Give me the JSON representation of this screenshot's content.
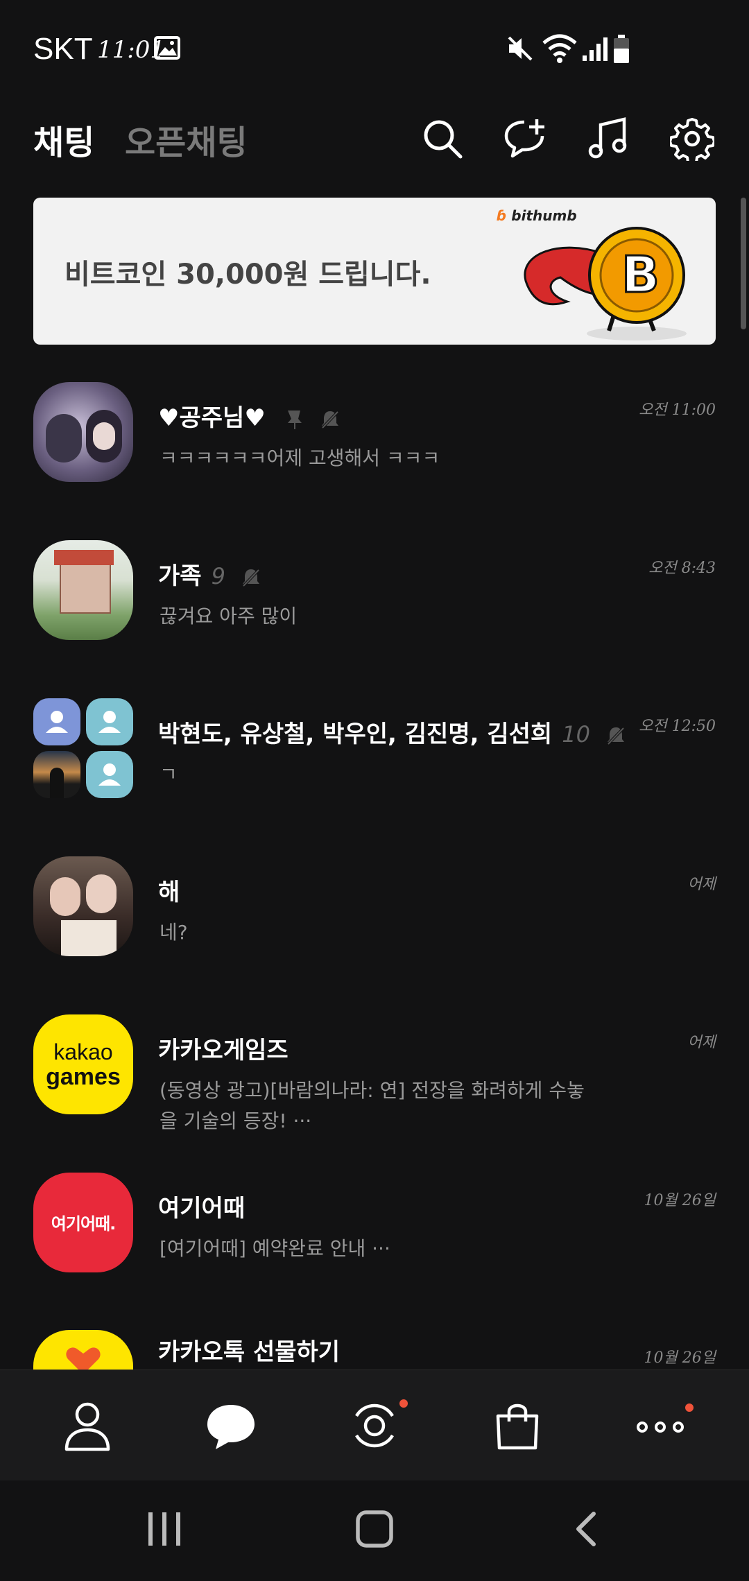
{
  "status_bar": {
    "carrier": "SKT",
    "time": "11:01"
  },
  "header": {
    "tabs": [
      {
        "label": "채팅",
        "active": true
      },
      {
        "label": "오픈채팅",
        "active": false
      }
    ]
  },
  "banner": {
    "text": "비트코인 30,000원 드립니다.",
    "brand": "bithumb"
  },
  "chats": [
    {
      "name": "♥공주님♥",
      "count": "",
      "preview": "ㅋㅋㅋㅋㅋㅋ어제 고생해서 ㅋㅋㅋ",
      "time": "오전 11:00",
      "pinned": true,
      "muted": true
    },
    {
      "name": "가족",
      "count": "9",
      "preview": "끊겨요 아주 많이",
      "time": "오전 8:43",
      "muted": true
    },
    {
      "name": "박현도, 유상철, 박우인, 김진명, 김선희",
      "count": "10",
      "preview": "ㄱ",
      "time": "오전 12:50",
      "muted": true
    },
    {
      "name": "해",
      "count": "",
      "preview": "네?",
      "time": "어제"
    },
    {
      "name": "카카오게임즈",
      "count": "",
      "preview": "(동영상 광고)[바람의나라: 연] 전장을 화려하게 수놓을 기술의 등장! ···",
      "time": "어제"
    },
    {
      "name": "여기어때",
      "count": "",
      "preview": "[여기어때] 예약완료 안내 ···",
      "time": "10월 26일"
    },
    {
      "name": "카카오톡 선물하기",
      "count": "",
      "preview": "",
      "time": "10월 26일"
    }
  ],
  "logos": {
    "kakao_games": [
      "kakao",
      "games"
    ],
    "yeogi": "여기어때."
  },
  "bottom_nav": [
    {
      "icon": "person-icon"
    },
    {
      "icon": "chat-bubble-icon",
      "active": true
    },
    {
      "icon": "view-icon",
      "badge": true
    },
    {
      "icon": "shopping-bag-icon"
    },
    {
      "icon": "more-icon",
      "badge": true
    }
  ],
  "colors": {
    "background": "#121213",
    "kakao_yellow": "#fee500",
    "yeogi_red": "#e8293a",
    "badge": "#f0533a"
  }
}
